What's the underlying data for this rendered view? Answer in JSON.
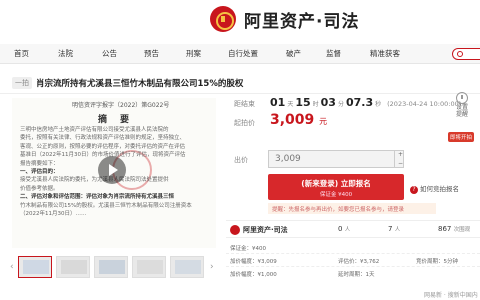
{
  "header": {
    "brand_name": "阿里资产·司法"
  },
  "nav": {
    "items": [
      "首页",
      "法院",
      "公告",
      "预告",
      "刑案",
      "自行处置",
      "破产",
      "监督",
      "精准获客"
    ]
  },
  "auction": {
    "tag": "一拍",
    "title": "肖宗流所持有尤溪县三恒竹木制品有限公司15%的股权"
  },
  "document": {
    "header_line": "明信资评字报字（2022）第G022号",
    "title": "摘　要",
    "lines": [
      "三明中信房地产土地资产评估有限公司接受尤溪县人民法院的",
      "委托，按照有关法律、行政法规和资产评估准则的规定，坚持独立、",
      "客观、公正的原则，按照必要的评估程序，对委托评估的资产在评估",
      "基准日（2022年11月30日）的市场价值进行了评估，现将资产评估",
      "报告摘要如下：",
      "一、评估目的：",
      "接受尤溪县人民法院的委托，为尤溪县人民法院司法处置提供",
      "价值参考依据。",
      "二、评估对象和评估范围：评估对象为肖宗流所持有尤溪县三恒",
      "竹木制品有限公司15%的股权。尤溪县三恒竹木制品有限公司注册资本",
      "（2022年11月30日）……"
    ],
    "emphasis_indexes": [
      5,
      8
    ]
  },
  "countdown": {
    "label": "距结束",
    "days": "01",
    "days_unit": "天",
    "hours": "15",
    "hours_unit": "时",
    "minutes": "03",
    "minutes_unit": "分",
    "seconds": "07.3",
    "seconds_unit": "秒",
    "end_text": "(2023-04-24 10:00:00)"
  },
  "reminder": {
    "line1": "设置",
    "line2": "提醒"
  },
  "price": {
    "label": "起拍价",
    "value": "3,009",
    "unit": "元"
  },
  "payment_tag": "即将开拍",
  "bid": {
    "label": "出价",
    "value": "3,009",
    "plus": "+",
    "minus": "−"
  },
  "register": {
    "label": "(新来登录) 立即报名",
    "deposit": "保证金 ¥400"
  },
  "how_to_bid": "如何竞拍报名",
  "notice": "提醒：先报名参与再出价，如要您已报名参与，请登录",
  "stats": {
    "brand": "阿里资产·司法",
    "stat1_value": "0",
    "stat1_label": "人",
    "stat2_value": "7",
    "stat2_label": "人",
    "stat3_value": "867",
    "stat3_label": "次围观"
  },
  "details": {
    "deposit": "保证金：¥400",
    "increment": "加价幅度：¥3,009",
    "assessed": "评估价：¥3,762",
    "bid_period": "竞价周期：5分钟",
    "sell": "加价幅度：¥1,000",
    "delay": "延时周期：1天"
  },
  "thumbs": {
    "prev": "‹",
    "next": "›"
  },
  "watermark": "网易新 · 搜新中国内"
}
